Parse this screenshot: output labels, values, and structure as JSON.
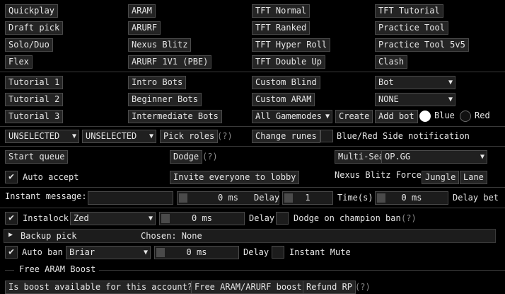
{
  "queues": {
    "col1": [
      "Quickplay",
      "Draft pick",
      "Solo/Duo",
      "Flex"
    ],
    "col2": [
      "ARAM",
      "ARURF",
      "Nexus Blitz",
      "ARURF 1V1 (PBE)"
    ],
    "col3": [
      "TFT Normal",
      "TFT Ranked",
      "TFT Hyper Roll",
      "TFT Double Up"
    ],
    "col4": [
      "TFT Tutorial",
      "Practice Tool",
      "Practice Tool 5v5",
      "Clash"
    ]
  },
  "lobby": {
    "tutorials": [
      "Tutorial 1",
      "Tutorial 2",
      "Tutorial 3"
    ],
    "bots": [
      "Intro Bots",
      "Beginner Bots",
      "Intermediate Bots"
    ],
    "custom_blind": "Custom Blind",
    "custom_aram": "Custom ARAM",
    "gamemodes_select": "All Gamemodes",
    "create": "Create",
    "bot_select": "Bot",
    "difficulty_select": "NONE",
    "add_bot": "Add bot",
    "team_blue": "Blue",
    "team_red": "Red"
  },
  "roles": {
    "role1": "UNSELECTED",
    "role2": "UNSELECTED",
    "pick_roles": "Pick roles",
    "help": "(?)",
    "change_runes": "Change runes",
    "side_notification": "Blue/Red Side notification"
  },
  "queue_actions": {
    "start_queue": "Start queue",
    "dodge": "Dodge",
    "dodge_help": "(?)",
    "multi_search": "Multi-Search",
    "site_select": "OP.GG"
  },
  "accept": {
    "auto_accept": "Auto accept",
    "invite": "Invite everyone to lobby",
    "force_label": "Nexus Blitz Force",
    "jungle": "Jungle",
    "lane": "Lane"
  },
  "message": {
    "label": "Instant message:",
    "value": "",
    "ms": "0 ms",
    "delay_label": "Delay",
    "times": "1",
    "times_label": "Time(s)",
    "ms2": "0 ms",
    "delay_between": "Delay bet"
  },
  "instalock": {
    "label": "Instalock",
    "champion": "Zed",
    "ms": "0 ms",
    "delay_label": "Delay",
    "dodge_ban": "Dodge on champion ban",
    "help": "(?)"
  },
  "backup": {
    "label": "Backup pick",
    "chosen": "Chosen: None"
  },
  "autoban": {
    "label": "Auto ban",
    "champion": "Briar",
    "ms": "0 ms",
    "delay_label": "Delay",
    "instant_mute": "Instant Mute"
  },
  "aram": {
    "section": "Free ARAM Boost",
    "is_available": "Is boost available for this account?",
    "free_boost": "Free ARAM/ARURF boost",
    "refund": "Refund RP",
    "help": "(?)"
  },
  "icons": {
    "check": "✔",
    "arrow": "▼",
    "expand": "▶"
  }
}
